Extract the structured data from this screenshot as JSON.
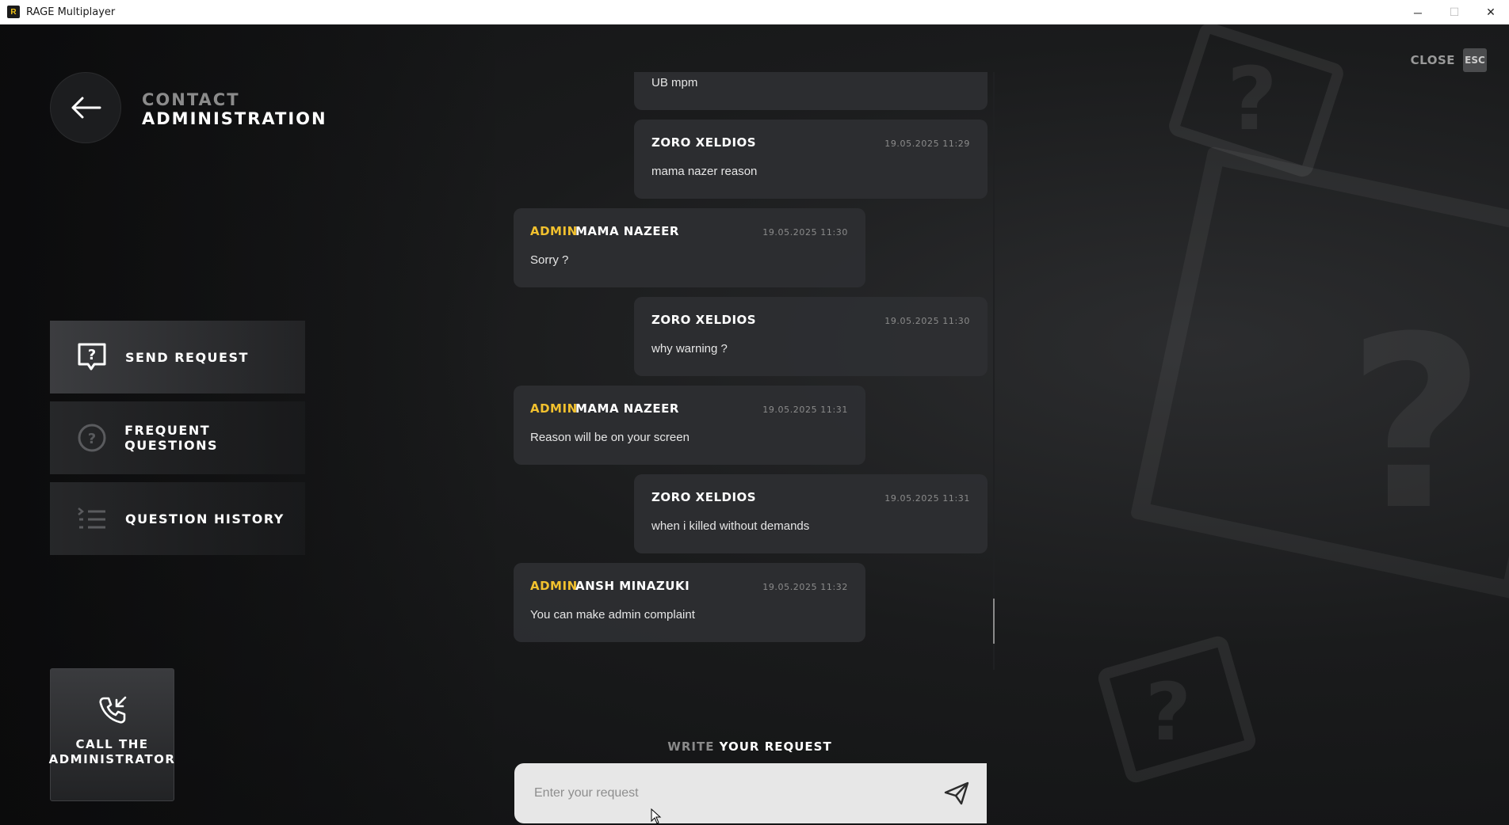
{
  "window": {
    "title": "RAGE Multiplayer",
    "app_icon_letter": "R",
    "minimize": "─",
    "maximize": "☐",
    "close": "✕"
  },
  "header": {
    "title_line1": "CONTACT",
    "title_line2": "ADMINISTRATION",
    "back_icon": "arrow-left-icon"
  },
  "close": {
    "label": "CLOSE",
    "key": "ESC"
  },
  "menu": [
    {
      "label": "SEND REQUEST",
      "icon": "question-chat-icon",
      "active": true
    },
    {
      "label": "FREQUENT QUESTIONS",
      "icon": "question-circle-icon",
      "active": false
    },
    {
      "label": "QUESTION HISTORY",
      "icon": "history-list-icon",
      "active": false
    }
  ],
  "call": {
    "label_line1": "CALL THE",
    "label_line2": "ADMINISTRATOR",
    "icon": "phone-incoming-icon"
  },
  "messages": [
    {
      "type": "user",
      "author": "",
      "time": "",
      "text": "UB mpm"
    },
    {
      "type": "user",
      "author": "ZORO XELDIOS",
      "time": "19.05.2025 11:29",
      "text": "mama nazer reason"
    },
    {
      "type": "admin",
      "role": "ADMIN",
      "author": "MAMA NAZEER",
      "time": "19.05.2025 11:30",
      "text": "Sorry ?"
    },
    {
      "type": "user",
      "author": "ZORO XELDIOS",
      "time": "19.05.2025 11:30",
      "text": "why warning ?"
    },
    {
      "type": "admin",
      "role": "ADMIN",
      "author": "MAMA NAZEER",
      "time": "19.05.2025 11:31",
      "text": "Reason will be on your screen"
    },
    {
      "type": "user",
      "author": "ZORO XELDIOS",
      "time": "19.05.2025 11:31",
      "text": "when i killed without demands"
    },
    {
      "type": "admin",
      "role": "ADMIN",
      "author": "ANSH MINAZUKI",
      "time": "19.05.2025 11:32",
      "text": "You can make admin complaint"
    }
  ],
  "input": {
    "caption_dim": "WRITE",
    "caption_bright": "YOUR REQUEST",
    "placeholder": "Enter your request",
    "value": "",
    "send_icon": "send-icon"
  },
  "colors": {
    "accent": "#f2c12e",
    "background": "#141516",
    "bubble": "#2e2f32",
    "input_bg": "#e7e7e7"
  }
}
